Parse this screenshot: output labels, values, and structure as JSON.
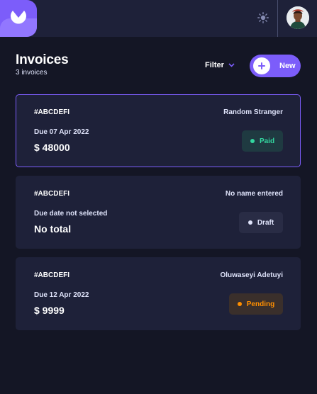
{
  "header": {
    "logo_icon": "logo-icon",
    "theme_icon": "sun-icon",
    "avatar": "user-avatar"
  },
  "main": {
    "title": "Invoices",
    "count": "3 invoices",
    "filter_label": "Filter",
    "filter_icon": "chevron-down-icon",
    "new_label": "New",
    "new_icon": "plus-icon"
  },
  "invoices": [
    {
      "id": "#ABCDEFI",
      "client": "Random Stranger",
      "due": "Due 07 Apr 2022",
      "total": "$ 48000",
      "status": "Paid"
    },
    {
      "id": "#ABCDEFI",
      "client": "No name entered",
      "due": "Due date not selected",
      "total": "No total",
      "status": "Draft"
    },
    {
      "id": "#ABCDEFI",
      "client": "Oluwaseyi Adetuyi",
      "due": "Due 12 Apr 2022",
      "total": "$ 9999",
      "status": "Pending"
    }
  ],
  "colors": {
    "accent": "#7c5dfa",
    "paid": "#33d69f",
    "pending": "#ff8f00",
    "draft": "#dfe3fa",
    "background": "#141625",
    "card": "#1e2139"
  }
}
